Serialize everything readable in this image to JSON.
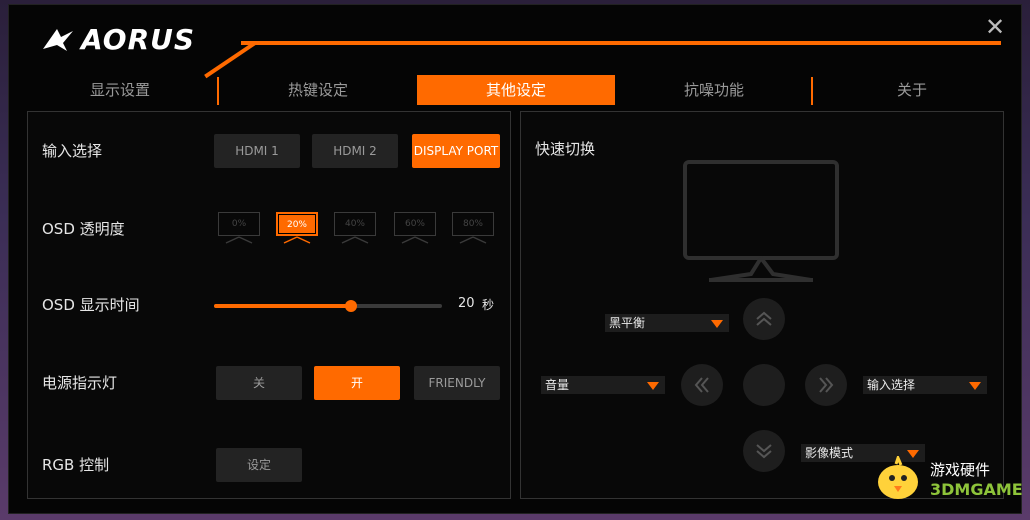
{
  "app": {
    "logo_text": "AORUS"
  },
  "tabs": [
    {
      "label": "显示设置"
    },
    {
      "label": "热键设定"
    },
    {
      "label": "其他设定"
    },
    {
      "label": "抗噪功能"
    },
    {
      "label": "关于"
    }
  ],
  "input_select": {
    "label": "输入选择",
    "options": [
      "HDMI 1",
      "HDMI 2",
      "DISPLAY PORT"
    ],
    "selected": "DISPLAY PORT"
  },
  "osd_transparency": {
    "label": "OSD 透明度",
    "options": [
      "0%",
      "20%",
      "40%",
      "60%",
      "80%"
    ],
    "selected": "20%"
  },
  "osd_display_time": {
    "label": "OSD 显示时间",
    "value": "20",
    "unit": "秒",
    "fraction": 0.6
  },
  "power_led": {
    "label": "电源指示灯",
    "options": [
      "关",
      "开",
      "FRIENDLY"
    ],
    "selected": "开"
  },
  "rgb": {
    "label": "RGB 控制",
    "button": "设定"
  },
  "quick_switch": {
    "title": "快速切换",
    "up": "黑平衡",
    "left": "音量",
    "right": "输入选择",
    "down": "影像模式"
  },
  "watermark": {
    "line1": "游戏硬件",
    "line2": "3DMGAME"
  },
  "colors": {
    "accent": "#ff6a00"
  }
}
